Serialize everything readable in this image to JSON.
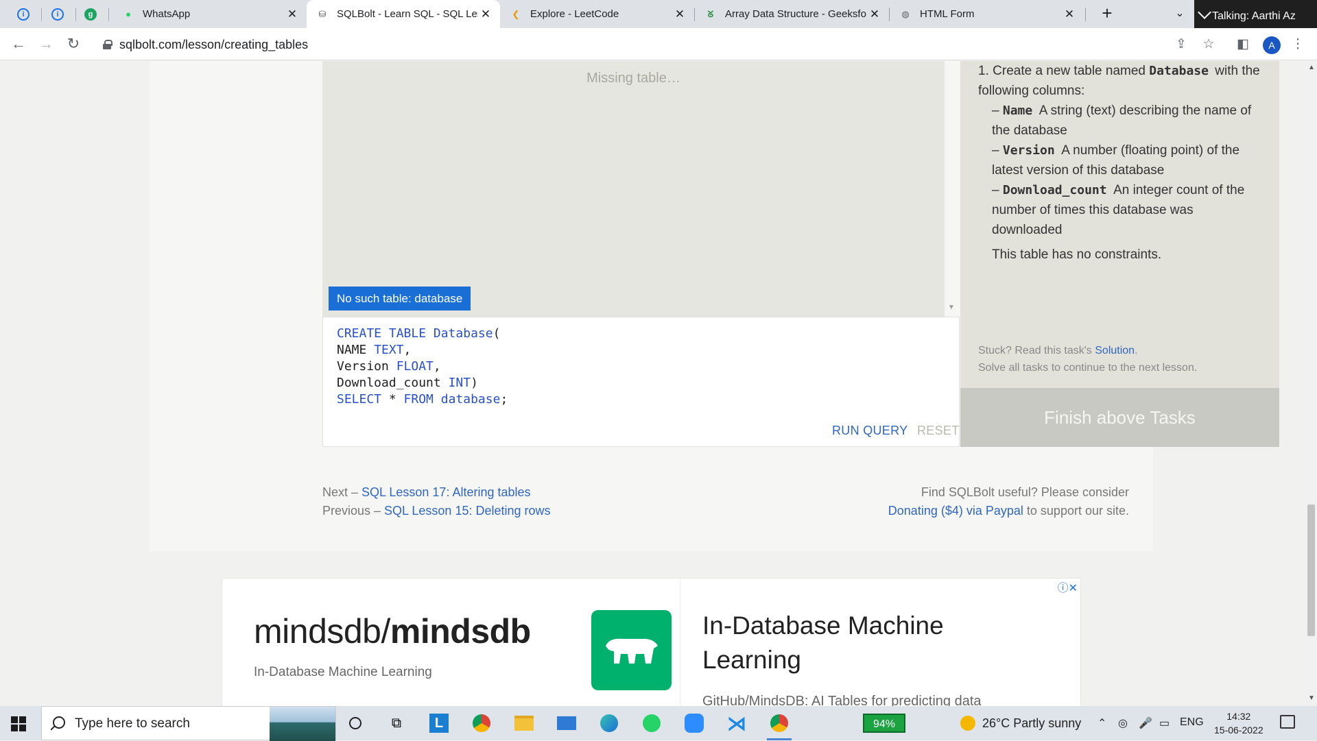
{
  "browser": {
    "pinned_tabs": [
      {
        "icon": "leetcode-style-icon"
      },
      {
        "icon": "leetcode-style-icon"
      },
      {
        "icon": "grammarly-icon"
      }
    ],
    "tabs": [
      {
        "label": "WhatsApp",
        "icon": "whatsapp-icon",
        "active": false
      },
      {
        "label": "SQLBolt - Learn SQL - SQL Less",
        "icon": "database-icon",
        "active": true
      },
      {
        "label": "Explore - LeetCode",
        "icon": "leetcode-icon",
        "active": false
      },
      {
        "label": "Array Data Structure - Geeksfo",
        "icon": "geeksforgeeks-icon",
        "active": false
      },
      {
        "label": "HTML Form",
        "icon": "globe-icon",
        "active": false
      }
    ],
    "url": "sqlbolt.com/lesson/creating_tables",
    "talking": "Talking: Aarthi  Az",
    "profile_initial": "A"
  },
  "results": {
    "missing_text": "Missing table…",
    "error_badge": "No such table: database"
  },
  "editor": {
    "code_lines": [
      [
        {
          "t": "CREATE TABLE Database",
          "k": true
        },
        {
          "t": "(",
          "k": false
        }
      ],
      [
        {
          "t": "NAME ",
          "k": false
        },
        {
          "t": "TEXT",
          "k": true
        },
        {
          "t": ",",
          "k": false
        }
      ],
      [
        {
          "t": "Version ",
          "k": false
        },
        {
          "t": "FLOAT",
          "k": true
        },
        {
          "t": ",",
          "k": false
        }
      ],
      [
        {
          "t": "Download_count ",
          "k": false
        },
        {
          "t": "INT",
          "k": true
        },
        {
          "t": ")",
          "k": false
        }
      ],
      [
        {
          "t": "SELECT",
          "k": true
        },
        {
          "t": " * ",
          "k": false
        },
        {
          "t": "FROM database",
          "k": true
        },
        {
          "t": ";",
          "k": false
        }
      ]
    ],
    "run_label": "RUN QUERY",
    "reset_label": "RESET"
  },
  "tasks": {
    "number": "1.",
    "intro_pre": "Create a new table named ",
    "table_name": "Database",
    "intro_post": " with the following columns:",
    "columns": [
      {
        "name": "Name",
        "desc": "A string (text) describing the name of the database"
      },
      {
        "name": "Version",
        "desc": "A number (floating point) of the latest version of this database"
      },
      {
        "name": "Download_count",
        "desc": "An integer count of the number of times this database was downloaded"
      }
    ],
    "constraint_text": "This table has no constraints.",
    "stuck_pre": "Stuck? Read this task's ",
    "solution_link": "Solution",
    "stuck_post": ".",
    "solve_all": "Solve all tasks to continue to the next lesson.",
    "finish_label": "Finish above Tasks"
  },
  "lesson_nav": {
    "next_prefix": "Next – ",
    "next_link": "SQL Lesson 17: Altering tables",
    "prev_prefix": "Previous – ",
    "prev_link": "SQL Lesson 15: Deleting rows",
    "donate_line1": "Find SQLBolt useful? Please consider",
    "donate_link": "Donating ($4) via Paypal",
    "donate_suffix": " to support our site."
  },
  "ad": {
    "title_light": "mindsdb/",
    "title_bold": "mindsdb",
    "subtitle": "In-Database Machine Learning",
    "headline": "In-Database Machine Learning",
    "small_text": "GitHub/MindsDB: AI Tables for predicting data",
    "close_glyphs": "ⓘ✕"
  },
  "taskbar": {
    "search_placeholder": "Type here to search",
    "battery": "94%",
    "weather": "26°C  Partly sunny",
    "language": "ENG",
    "time": "14:32",
    "date": "15-06-2022"
  }
}
